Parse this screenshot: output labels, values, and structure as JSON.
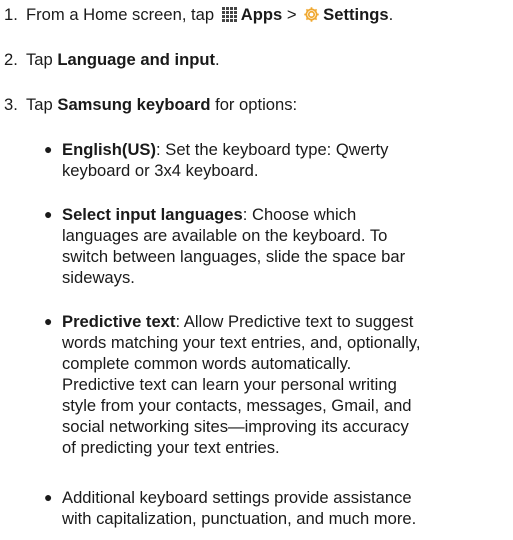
{
  "steps": [
    {
      "number": "1.",
      "text_before": "From a Home screen, tap ",
      "apps_label": "Apps",
      "separator": " > ",
      "settings_label": "Settings",
      "text_after": "."
    },
    {
      "number": "2.",
      "text_before": "Tap ",
      "bold": "Language and input",
      "text_after": "."
    },
    {
      "number": "3.",
      "text_before": "Tap ",
      "bold": "Samsung keyboard",
      "text_after": " for options:"
    }
  ],
  "bullets": [
    {
      "bold": "English(US)",
      "line1_rest": ": Set the keyboard type: Qwerty",
      "lines": [
        "keyboard or 3x4 keyboard."
      ]
    },
    {
      "bold": "Select input languages",
      "line1_rest": ": Choose which",
      "lines": [
        "languages are available on the keyboard. To",
        "switch between languages, slide the space bar",
        "sideways."
      ]
    },
    {
      "bold": "Predictive text",
      "line1_rest": ": Allow Predictive text to suggest",
      "lines": [
        "words matching your text entries, and, optionally,",
        "complete common words automatically.",
        "Predictive text can learn your personal writing",
        "style from your contacts, messages, Gmail, and",
        "social networking sites—improving its accuracy",
        "of predicting your text entries."
      ]
    },
    {
      "bold": "",
      "line1_rest": "Additional keyboard settings provide assistance",
      "lines": [
        "with capitalization, punctuation, and much more."
      ]
    }
  ],
  "icons": {
    "apps": "apps-grid-icon",
    "settings": "settings-gear-icon",
    "settings_color": "#f0a830"
  }
}
